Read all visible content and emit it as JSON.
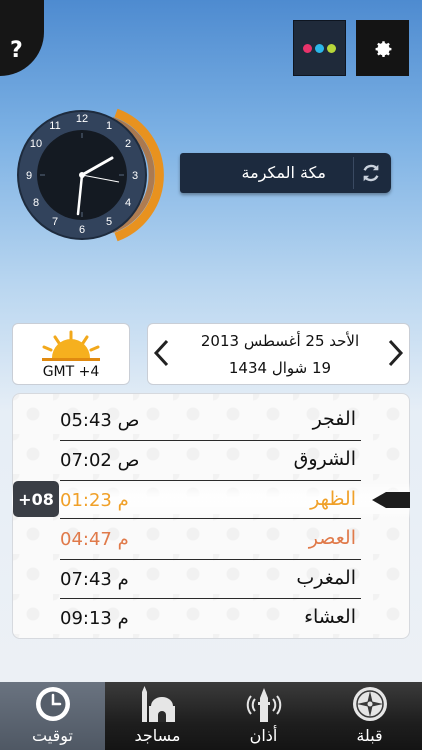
{
  "header": {
    "help_label": "?",
    "theme_dot_colors": [
      "#e8336b",
      "#2bb7e9",
      "#b7d63a"
    ],
    "icons": {
      "help": "question-mark",
      "theme": "color-dots-icon",
      "settings": "gear-icon"
    }
  },
  "clock": {
    "numbers": [
      "12",
      "1",
      "2",
      "3",
      "4",
      "5",
      "6",
      "7",
      "8",
      "9",
      "10",
      "11"
    ],
    "time_shown": "2:32"
  },
  "city": {
    "name": "مكة المكرمة",
    "sync_icon": "refresh-icon"
  },
  "timezone": {
    "label": "GMT +4",
    "icon": "sun-icon"
  },
  "date": {
    "gregorian": "الأحد 25 أغسطس 2013",
    "hijri": "19 شوال 1434",
    "prev_icon": "chevron-left-icon",
    "next_icon": "chevron-right-icon"
  },
  "prayers": [
    {
      "name": "الفجر",
      "time": "05:43 ص",
      "color": "#111111"
    },
    {
      "name": "الشروق",
      "time": "07:02 ص",
      "color": "#111111"
    },
    {
      "name": "الظهر",
      "time": "01:23 م",
      "color": "#f0a028"
    },
    {
      "name": "العصر",
      "time": "04:47 م",
      "color": "#e07a4a"
    },
    {
      "name": "المغرب",
      "time": "07:43 م",
      "color": "#111111"
    },
    {
      "name": "العشاء",
      "time": "09:13 م",
      "color": "#111111"
    }
  ],
  "offset_badge": "+08",
  "tabs": [
    {
      "label": "توقيت",
      "icon": "clock-icon",
      "active": true
    },
    {
      "label": "مساجد",
      "icon": "mosque-icon",
      "active": false
    },
    {
      "label": "أذان",
      "icon": "minaret-icon",
      "active": false
    },
    {
      "label": "قبلة",
      "icon": "compass-icon",
      "active": false
    }
  ]
}
